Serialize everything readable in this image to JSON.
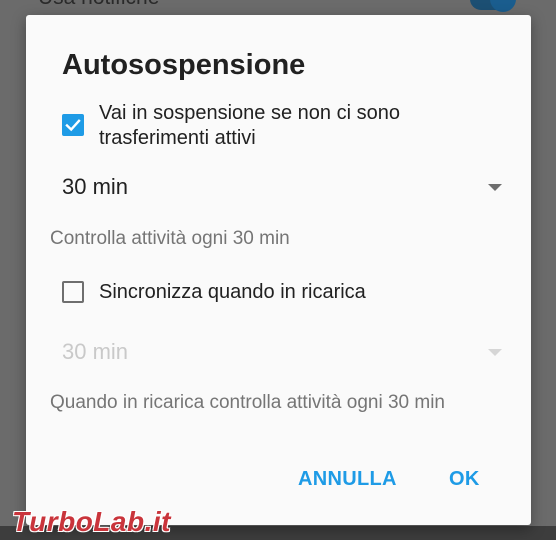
{
  "background": {
    "setting_label": "Usa notifiche",
    "watermark": "TurboLab.it"
  },
  "dialog": {
    "title": "Autosospensione",
    "suspend": {
      "checked": true,
      "label": "Vai in sospensione se non ci sono trasferimenti attivi",
      "interval_value": "30 min",
      "summary": "Controlla attività ogni 30 min"
    },
    "charging": {
      "checked": false,
      "label": "Sincronizza quando in ricarica",
      "interval_value": "30 min",
      "summary": "Quando in ricarica controlla attività ogni 30 min"
    },
    "buttons": {
      "cancel": "ANNULLA",
      "ok": "OK"
    }
  },
  "colors": {
    "accent": "#1e9be6",
    "dialog_bg": "#fafafa",
    "scrim": "#6b6b6b",
    "watermark": "#c9343b"
  }
}
